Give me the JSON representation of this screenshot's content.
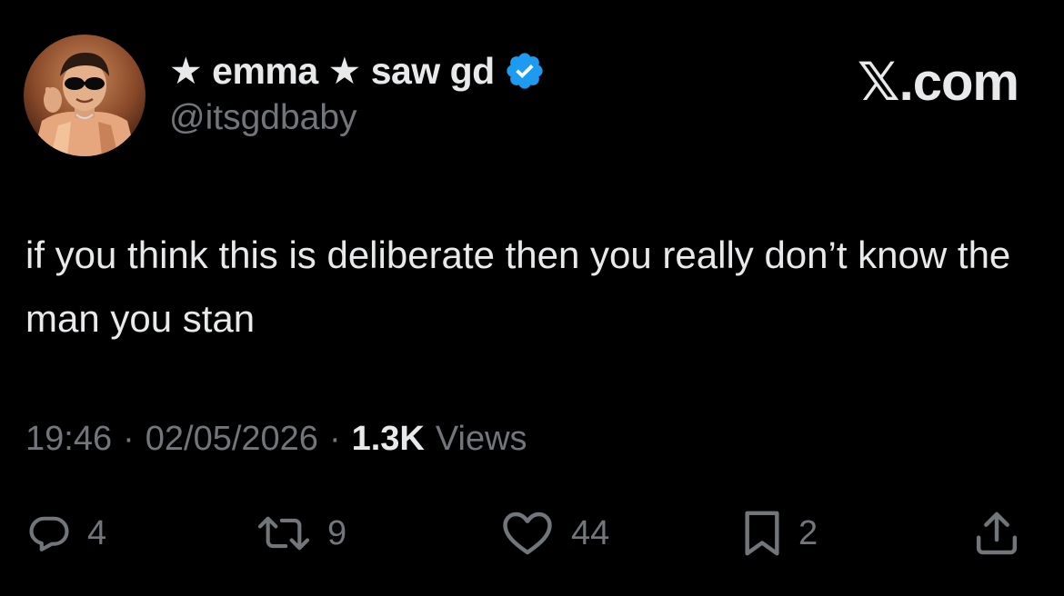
{
  "author": {
    "display_name": "★ emma ★ saw gd",
    "handle": "@itsgdbaby",
    "verified": true,
    "verified_color": "#1d9bf0",
    "avatar": "avatar-photo"
  },
  "site": {
    "label": "𝕏.com"
  },
  "tweet": {
    "text": "if you think this is deliberate then you really don’t know the man you stan"
  },
  "meta": {
    "time": "19:46",
    "separator": "·",
    "date": "02/05/2026",
    "views_count": "1.3K",
    "views_label": "Views"
  },
  "actions": {
    "reply": {
      "icon": "reply-icon",
      "count": "4"
    },
    "retweet": {
      "icon": "retweet-icon",
      "count": "9"
    },
    "like": {
      "icon": "heart-icon",
      "count": "44"
    },
    "bookmark": {
      "icon": "bookmark-icon",
      "count": "2"
    },
    "share": {
      "icon": "share-icon"
    }
  },
  "colors": {
    "background": "#000000",
    "primary_text": "#e7e9ea",
    "secondary_text": "#71767b"
  }
}
